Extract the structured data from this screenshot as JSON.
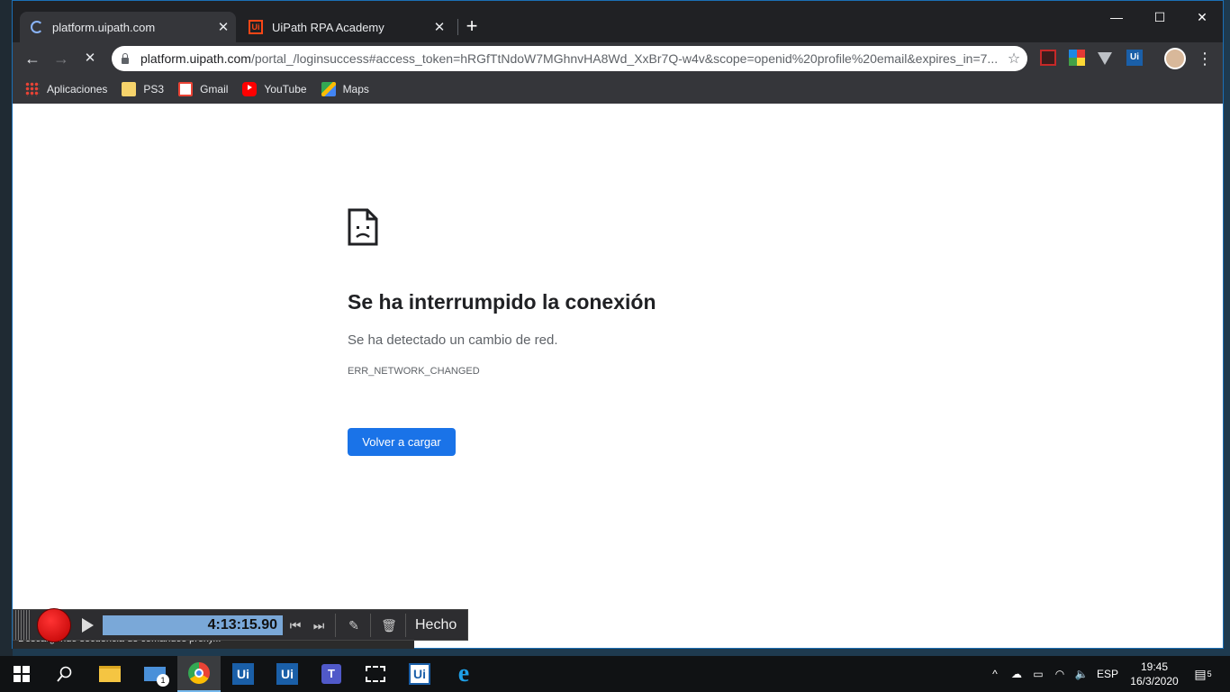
{
  "browser": {
    "tabs": [
      {
        "title": "platform.uipath.com",
        "active": true
      },
      {
        "title": "UiPath RPA Academy",
        "active": false
      }
    ],
    "new_tab_label": "+",
    "window_controls": {
      "minimize": "—",
      "maximize": "☐",
      "close": "✕"
    },
    "nav": {
      "back": "←",
      "forward": "→",
      "stop": "✕"
    },
    "omnibox": {
      "host": "platform.uipath.com",
      "path": "/portal_/loginsuccess#access_token=hRGfTtNdoW7MGhnvHA8Wd_XxBr7Q-w4v&scope=openid%20profile%20email&expires_in=7..."
    },
    "bookmarks": [
      {
        "label": "Aplicaciones",
        "icon": "apps-grid-icon"
      },
      {
        "label": "PS3",
        "icon": "folder-icon"
      },
      {
        "label": "Gmail",
        "icon": "gmail-icon"
      },
      {
        "label": "YouTube",
        "icon": "youtube-icon"
      },
      {
        "label": "Maps",
        "icon": "maps-icon"
      }
    ],
    "extensions": [
      "pdf-icon",
      "color-grid-icon",
      "vee-icon",
      "uipath-icon"
    ]
  },
  "error_page": {
    "title": "Se ha interrumpido la conexión",
    "subtitle": "Se ha detectado un cambio de red.",
    "code": "ERR_NETWORK_CHANGED",
    "reload_label": "Volver a cargar"
  },
  "status_bar": {
    "text": "Descargando secuencia de comandos proxy..."
  },
  "recorder": {
    "timer": "4:13:15.90",
    "done_label": "Hecho"
  },
  "taskbar": {
    "mail_badge": "1",
    "tray": {
      "language": "ESP",
      "time": "19:45",
      "date": "16/3/2020",
      "notifications": "5"
    }
  },
  "colors": {
    "accent": "#1a73e8",
    "chrome_dark": "#35363a",
    "tab_strip": "#202124",
    "record_red": "#e01010"
  }
}
